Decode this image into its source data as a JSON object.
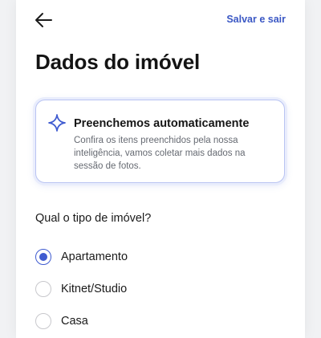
{
  "header": {
    "back_icon": "arrow-left-icon",
    "save_label": "Salvar e sair"
  },
  "page": {
    "title": "Dados do imóvel"
  },
  "info_card": {
    "icon": "sparkle-icon",
    "title": "Preenchemos automaticamente",
    "text": "Confira os itens preenchidos pela nossa inteligência, vamos coletar mais dados na sessão de fotos."
  },
  "property_type": {
    "question": "Qual o tipo de imóvel?",
    "options": [
      {
        "label": "Apartamento",
        "selected": true
      },
      {
        "label": "Kitnet/Studio",
        "selected": false
      },
      {
        "label": "Casa",
        "selected": false
      }
    ]
  },
  "colors": {
    "accent": "#3f5bd0",
    "link": "#3a57c4",
    "info_border": "#b9c3f2"
  }
}
